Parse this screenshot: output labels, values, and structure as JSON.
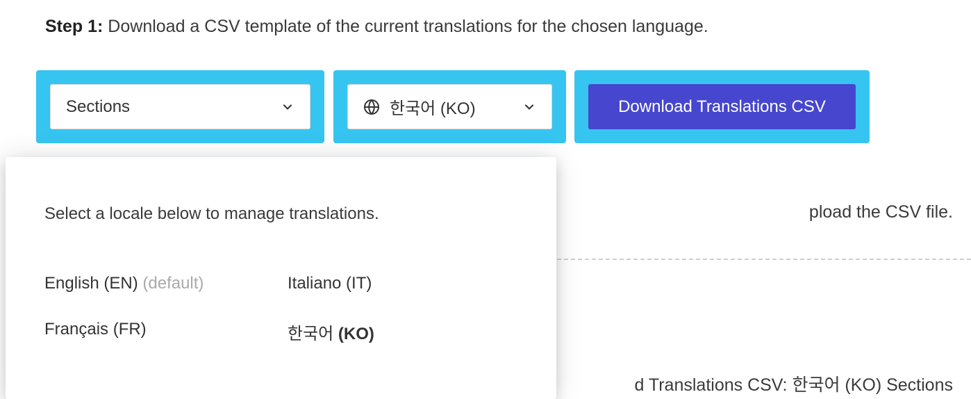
{
  "step1": {
    "prefix": "Step 1:",
    "text": " Download a CSV template of the current translations for the chosen language."
  },
  "sections_select": {
    "label": "Sections"
  },
  "locale_select": {
    "label": "한국어 (KO)"
  },
  "download_btn": {
    "label": "Download Translations CSV"
  },
  "partial_right": "pload the CSV file.",
  "bottom_right": "d Translations CSV: 한국어 (KO) Sections",
  "plus": "+",
  "dropdown": {
    "prompt": "Select a locale below to manage translations.",
    "items": [
      {
        "label": "English (EN) ",
        "default": "(default)"
      },
      {
        "label": "Italiano (IT)"
      },
      {
        "label": "Français (FR)"
      },
      {
        "label": "한국어 ",
        "code": "(KO)"
      }
    ]
  }
}
